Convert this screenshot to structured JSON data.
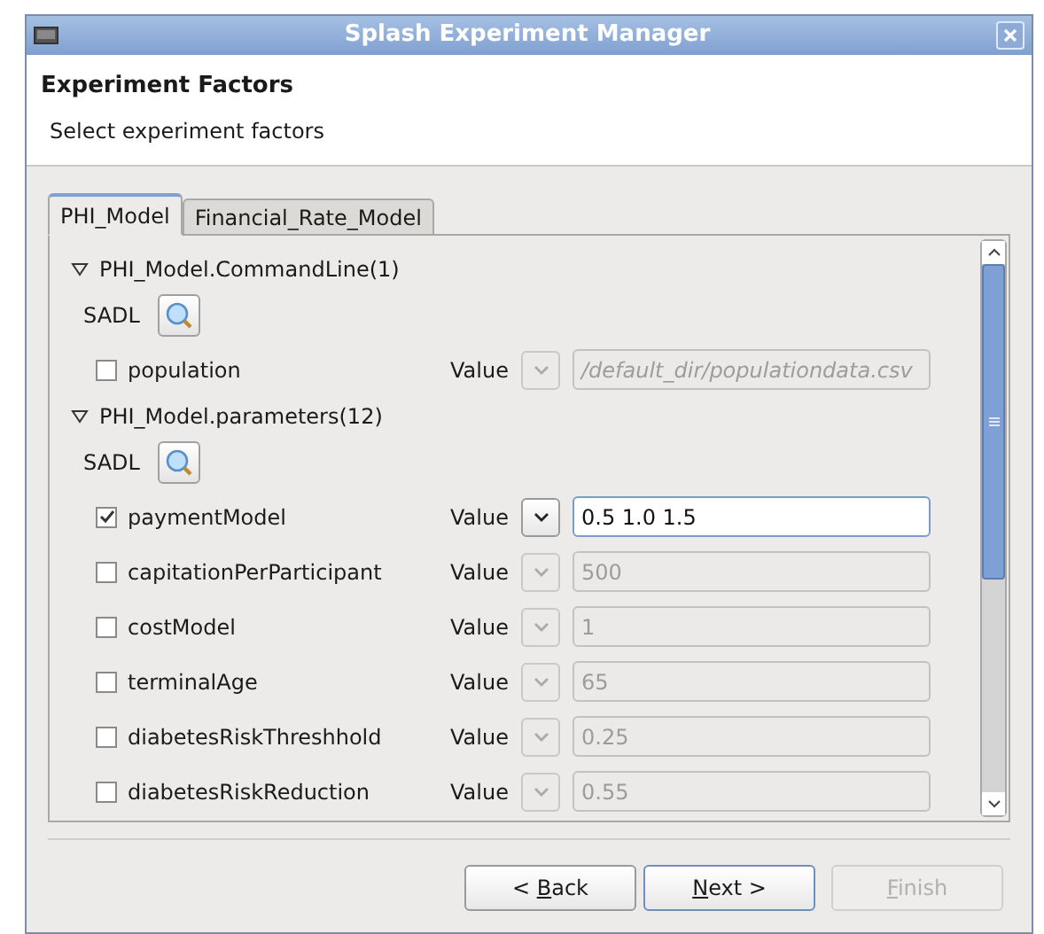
{
  "window": {
    "title": "Splash Experiment Manager"
  },
  "header": {
    "title": "Experiment Factors",
    "subtitle": "Select experiment factors"
  },
  "tabs": [
    {
      "label": "PHI_Model",
      "selected": true
    },
    {
      "label": "Financial_Rate_Model",
      "selected": false
    }
  ],
  "groups": [
    {
      "title": "PHI_Model.CommandLine(1)",
      "expanded": true,
      "sadl_label": "SADL",
      "factors": [
        {
          "name": "population",
          "checked": false,
          "value_label": "Value",
          "value": "/default_dir/populationdata.csv",
          "italic": true
        }
      ]
    },
    {
      "title": "PHI_Model.parameters(12)",
      "expanded": true,
      "sadl_label": "SADL",
      "factors": [
        {
          "name": "paymentModel",
          "checked": true,
          "value_label": "Value",
          "value": "0.5 1.0 1.5",
          "italic": false
        },
        {
          "name": "capitationPerParticipant",
          "checked": false,
          "value_label": "Value",
          "value": "500",
          "italic": false
        },
        {
          "name": "costModel",
          "checked": false,
          "value_label": "Value",
          "value": "1",
          "italic": false
        },
        {
          "name": "terminalAge",
          "checked": false,
          "value_label": "Value",
          "value": "65",
          "italic": false
        },
        {
          "name": "diabetesRiskThreshhold",
          "checked": false,
          "value_label": "Value",
          "value": "0.25",
          "italic": false
        },
        {
          "name": "diabetesRiskReduction",
          "checked": false,
          "value_label": "Value",
          "value": "0.55",
          "italic": false
        }
      ]
    }
  ],
  "buttons": [
    {
      "label_before": "< ",
      "mnemonic": "B",
      "label_after": "ack",
      "disabled": false,
      "default": false
    },
    {
      "mnemonic": "N",
      "label_after": "ext >",
      "disabled": false,
      "default": true
    },
    {
      "mnemonic": "F",
      "label_after": "inish",
      "disabled": true,
      "default": false
    }
  ]
}
